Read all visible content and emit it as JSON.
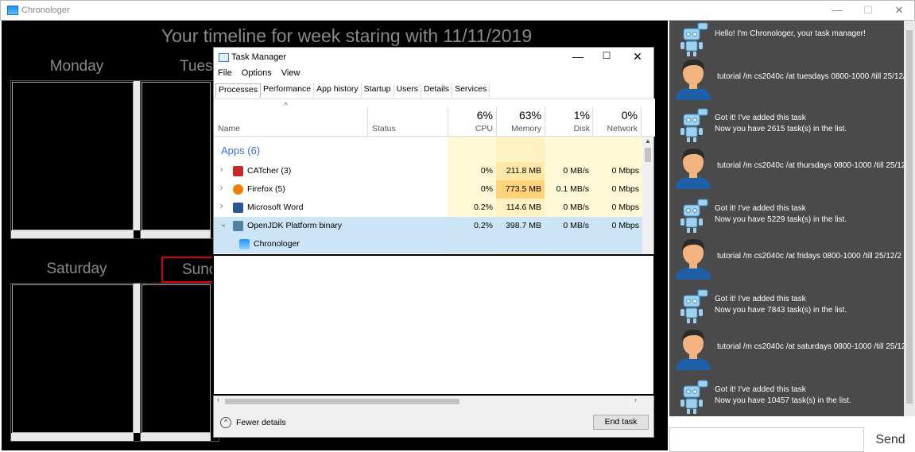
{
  "window": {
    "title": "Chronologer",
    "minimize_glyph": "—",
    "maximize_glyph": "☐",
    "close_glyph": "✕"
  },
  "calendar": {
    "heading": "Your timeline for week staring with 11/11/2019",
    "days": [
      "Monday",
      "Tuesday",
      "Saturday",
      "Sunday"
    ],
    "selected_day": "Sunday"
  },
  "chat": {
    "messages": [
      {
        "from": "bot",
        "lines": [
          "Hello! I'm Chronologer, your task manager!"
        ]
      },
      {
        "from": "user",
        "lines": [
          "tutorial /m cs2040c /at tuesdays 0800-1000 /till 25/12/2"
        ]
      },
      {
        "from": "bot",
        "lines": [
          "Got it! I've added this task",
          "Now you have 2615 task(s) in the list."
        ]
      },
      {
        "from": "user",
        "lines": [
          "tutorial /m cs2040c /at thursdays 0800-1000 /till 25/12/"
        ]
      },
      {
        "from": "bot",
        "lines": [
          "Got it! I've added this task",
          "Now you have 5229 task(s) in the list."
        ]
      },
      {
        "from": "user",
        "lines": [
          "tutorial /m cs2040c /at fridays 0800-1000 /till 25/12/2"
        ]
      },
      {
        "from": "bot",
        "lines": [
          "Got it! I've added this task",
          "Now you have 7843 task(s) in the list."
        ]
      },
      {
        "from": "user",
        "lines": [
          "tutorial /m cs2040c /at saturdays 0800-1000 /till 25/12/"
        ]
      },
      {
        "from": "bot",
        "lines": [
          "Got it! I've added this task",
          "Now you have 10457 task(s) in the list."
        ]
      }
    ],
    "input_value": "",
    "send_label": "Send"
  },
  "task_manager": {
    "title": "Task Manager",
    "menu": [
      "File",
      "Options",
      "View"
    ],
    "tabs": [
      "Processes",
      "Performance",
      "App history",
      "Startup",
      "Users",
      "Details",
      "Services"
    ],
    "active_tab": "Processes",
    "columns": {
      "name": "Name",
      "status": "Status",
      "cpu": {
        "label": "CPU",
        "pct": "6%"
      },
      "memory": {
        "label": "Memory",
        "pct": "63%"
      },
      "disk": {
        "label": "Disk",
        "pct": "1%"
      },
      "network": {
        "label": "Network",
        "pct": "0%"
      }
    },
    "group": "Apps (6)",
    "rows": [
      {
        "name": "CATcher (3)",
        "icon": "catcher-icon",
        "icon_color": "#c62828",
        "cpu": "0%",
        "memory": "211.8 MB",
        "disk": "0 MB/s",
        "network": "0 Mbps",
        "expanded": false
      },
      {
        "name": "Firefox (5)",
        "icon": "firefox-icon",
        "icon_color": "#f57c00",
        "cpu": "0%",
        "memory": "773.5 MB",
        "disk": "0.1 MB/s",
        "network": "0 Mbps",
        "expanded": false
      },
      {
        "name": "Microsoft Word",
        "icon": "word-icon",
        "icon_color": "#2b579a",
        "cpu": "0.2%",
        "memory": "114.6 MB",
        "disk": "0 MB/s",
        "network": "0 Mbps",
        "expanded": false
      },
      {
        "name": "OpenJDK Platform binary",
        "icon": "java-icon",
        "icon_color": "#5382a1",
        "cpu": "0.2%",
        "memory": "398.7 MB",
        "disk": "0 MB/s",
        "network": "0 Mbps",
        "expanded": true
      }
    ],
    "child_row": {
      "name": "Chronologer",
      "icon": "chronologer-icon"
    },
    "fewer_details": "Fewer details",
    "end_task": "End task"
  }
}
